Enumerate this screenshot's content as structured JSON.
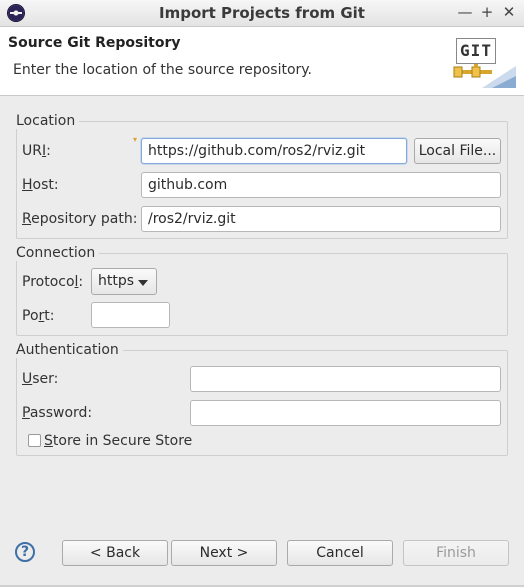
{
  "window": {
    "title": "Import Projects from Git",
    "minimize": "—",
    "maximize": "+",
    "close": "✕"
  },
  "header": {
    "title": "Source Git Repository",
    "description": "Enter the location of the source repository.",
    "logo_text": "GIT"
  },
  "location": {
    "legend": "Location",
    "uri_label_pre": "UR",
    "uri_label_mnemonic": "I",
    "uri_label_post": ":",
    "uri_value": "https://github.com/ros2/rviz.git",
    "local_file_button": "Local File...",
    "host_label_mnemonic": "H",
    "host_label_post": "ost:",
    "host_value": "github.com",
    "repo_label_mnemonic": "R",
    "repo_label_post": "epository path:",
    "repo_value": "/ros2/rviz.git"
  },
  "connection": {
    "legend": "Connection",
    "protocol_label_pre": "Protoco",
    "protocol_label_mnemonic": "l",
    "protocol_label_post": ":",
    "protocol_value": "https",
    "port_label_pre": "Po",
    "port_label_mnemonic": "r",
    "port_label_post": "t:",
    "port_value": ""
  },
  "authentication": {
    "legend": "Authentication",
    "user_label_mnemonic": "U",
    "user_label_post": "ser:",
    "user_value": "",
    "password_label_mnemonic": "P",
    "password_label_post": "assword:",
    "password_value": "",
    "store_label_mnemonic": "S",
    "store_label_post": "tore in Secure Store",
    "store_checked": false
  },
  "buttons": {
    "help": "?",
    "back": "< Back",
    "next": "Next >",
    "cancel": "Cancel",
    "finish": "Finish"
  }
}
